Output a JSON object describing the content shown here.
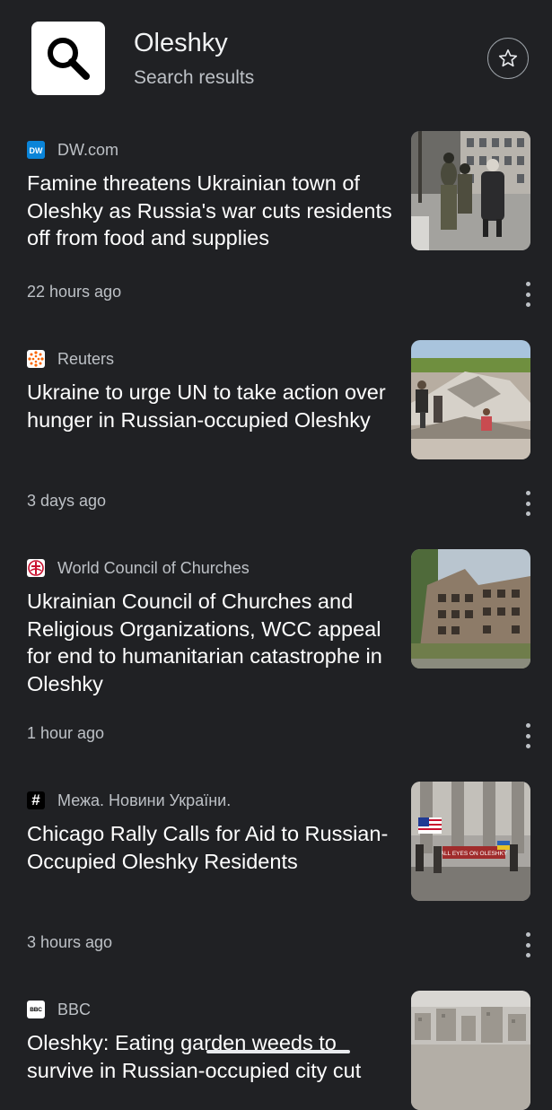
{
  "header": {
    "title": "Oleshky",
    "subtitle": "Search results",
    "app_icon": "search-icon",
    "star_icon": "star-outline-icon"
  },
  "articles": [
    {
      "source": "DW.com",
      "source_icon": "dw-logo-icon",
      "headline": "Famine threatens Ukrainian town of Oleshky as Russia's war cuts residents off from food and supplies",
      "time": "22 hours ago",
      "thumbnail": "soldiers-with-elderly-woman-photo"
    },
    {
      "source": "Reuters",
      "source_icon": "reuters-logo-icon",
      "headline": "Ukraine to urge UN to take action over hunger in Russian-occupied Oleshky",
      "time": "3 days ago",
      "thumbnail": "rubble-destroyed-building-photo"
    },
    {
      "source": "World Council of Churches",
      "source_icon": "wcc-logo-icon",
      "headline": "Ukrainian Council of Churches and Religious Organizations, WCC appeal for end to humanitarian catastrophe in Oleshky",
      "time": "1 hour ago",
      "thumbnail": "damaged-apartment-block-photo"
    },
    {
      "source": "Межа. Новини України.",
      "source_icon": "hash-logo-icon",
      "source_icon_text": "#",
      "headline": "Chicago Rally Calls for Aid to Russian-Occupied Oleshky Residents",
      "time": "3 hours ago",
      "thumbnail": "rally-with-banner-photo",
      "thumbnail_text": "ALL EYES ON OLESHKY"
    },
    {
      "source": "BBC",
      "source_icon": "bbc-logo-icon",
      "source_icon_text": "BBC",
      "headline": "Oleshky: Eating garden weeds to survive in Russian-occupied city cut",
      "thumbnail": "city-aerial-photo"
    }
  ],
  "colors": {
    "background": "#202124",
    "headline": "#ffffff",
    "secondary_text": "#bdc1c6"
  }
}
